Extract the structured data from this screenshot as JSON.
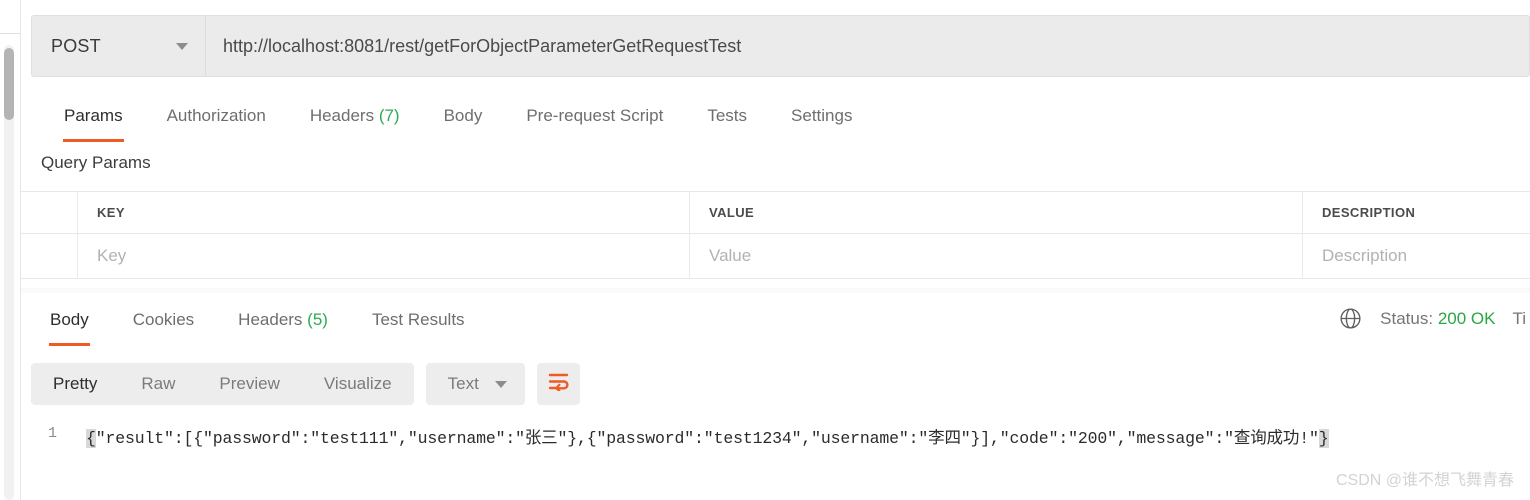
{
  "request": {
    "method": "POST",
    "url": "http://localhost:8081/rest/getForObjectParameterGetRequestTest",
    "tabs": [
      {
        "label": "Params",
        "count": "",
        "active": true
      },
      {
        "label": "Authorization",
        "count": "",
        "active": false
      },
      {
        "label": "Headers",
        "count": "(7)",
        "active": false
      },
      {
        "label": "Body",
        "count": "",
        "active": false
      },
      {
        "label": "Pre-request Script",
        "count": "",
        "active": false
      },
      {
        "label": "Tests",
        "count": "",
        "active": false
      },
      {
        "label": "Settings",
        "count": "",
        "active": false
      }
    ],
    "section_title": "Query Params",
    "table": {
      "headers": [
        "KEY",
        "VALUE",
        "DESCRIPTION"
      ],
      "placeholders": [
        "Key",
        "Value",
        "Description"
      ]
    }
  },
  "response": {
    "tabs": [
      {
        "label": "Body",
        "count": "",
        "active": true
      },
      {
        "label": "Cookies",
        "count": "",
        "active": false
      },
      {
        "label": "Headers",
        "count": "(5)",
        "active": false
      },
      {
        "label": "Test Results",
        "count": "",
        "active": false
      }
    ],
    "status_label": "Status:",
    "status_value": "200 OK",
    "time_label": "Ti",
    "format_tabs": [
      {
        "label": "Pretty",
        "active": true
      },
      {
        "label": "Raw",
        "active": false
      },
      {
        "label": "Preview",
        "active": false
      },
      {
        "label": "Visualize",
        "active": false
      }
    ],
    "language": "Text",
    "body_line_number": "1",
    "body_open_brace": "{",
    "body_text": "\"result\":[{\"password\":\"test111\",\"username\":\"张三\"},{\"password\":\"test1234\",\"username\":\"李四\"}],\"code\":\"200\",\"message\":\"查询成功!\"",
    "body_close_brace": "}"
  },
  "watermark": "CSDN @谁不想飞舞青春",
  "colors": {
    "accent": "#ef5b25",
    "success": "#27a745",
    "count": "#2faa54",
    "toolbar_bg": "#ededed"
  }
}
